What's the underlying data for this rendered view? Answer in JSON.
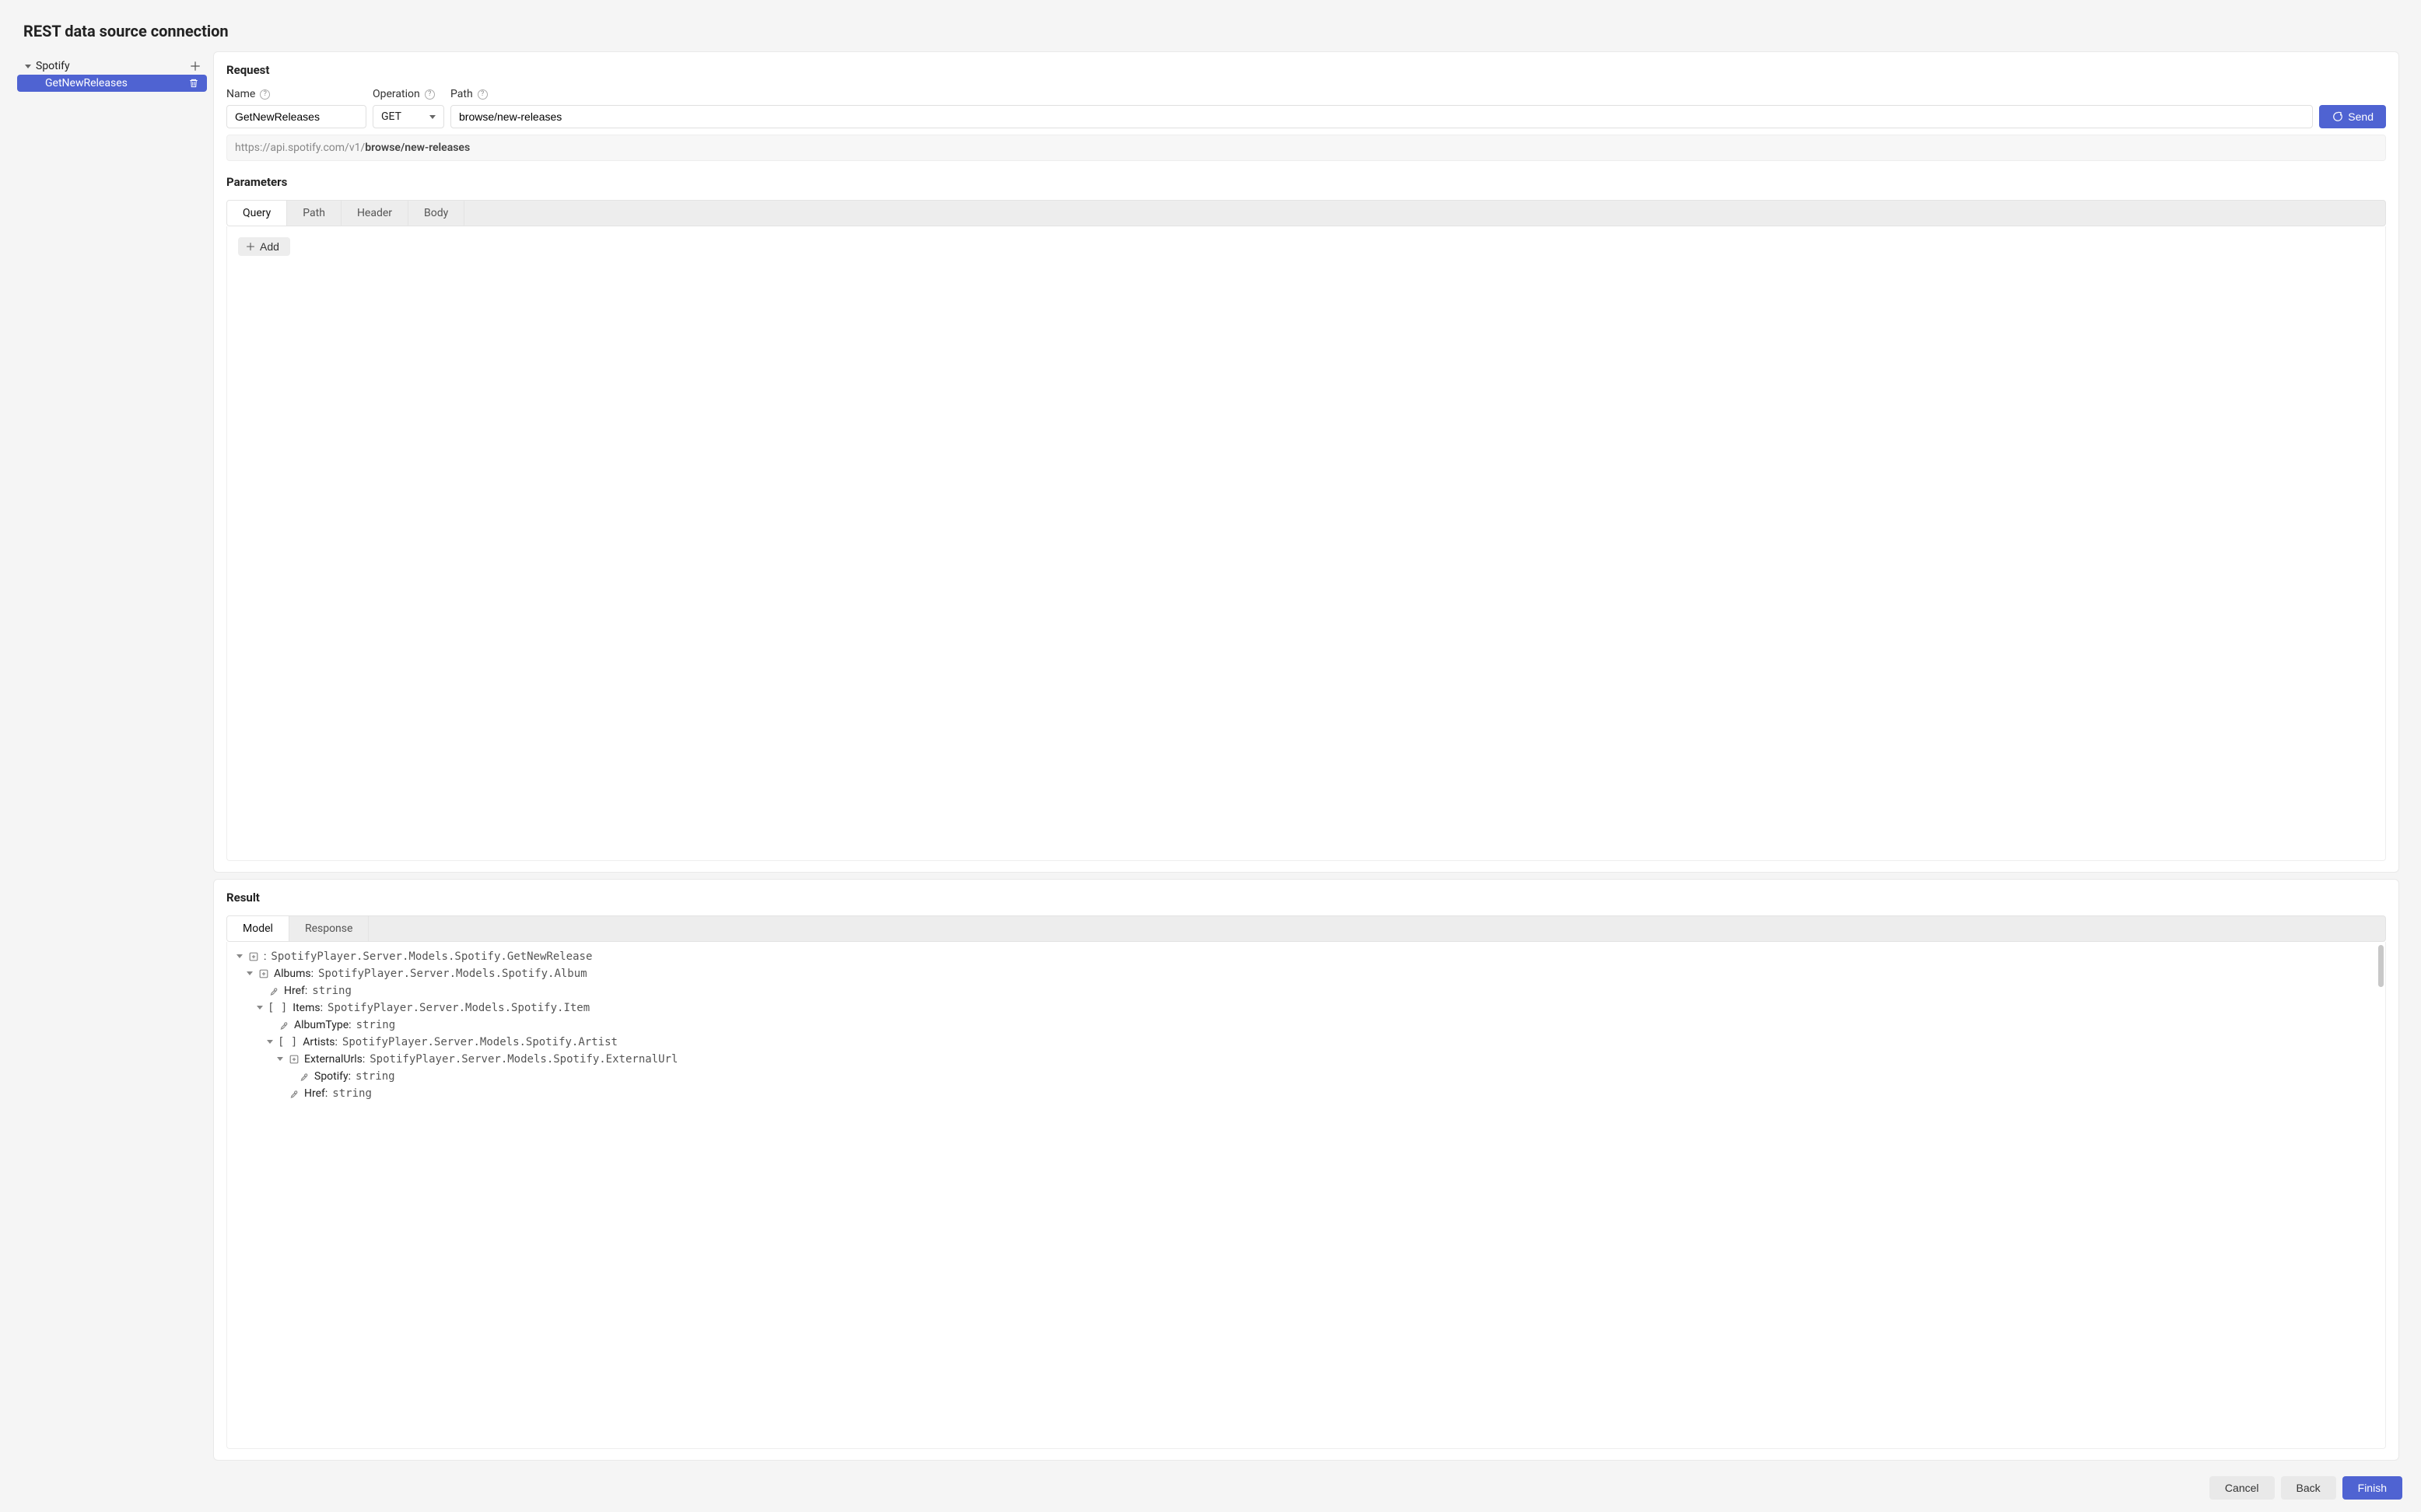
{
  "title": "REST data source connection",
  "sidebar": {
    "root": "Spotify",
    "leaf": "GetNewReleases"
  },
  "request": {
    "section": "Request",
    "name_label": "Name",
    "name_value": "GetNewReleases",
    "operation_label": "Operation",
    "operation_value": "GET",
    "path_label": "Path",
    "path_value": "browse/new-releases",
    "send": "Send",
    "url_base": "https://api.spotify.com/v1/",
    "url_path": "browse/new-releases"
  },
  "parameters": {
    "section": "Parameters",
    "tabs": [
      "Query",
      "Path",
      "Header",
      "Body"
    ],
    "add": "Add"
  },
  "result": {
    "section": "Result",
    "tabs": [
      "Model",
      "Response"
    ],
    "tree": [
      {
        "indent": 0,
        "chev": true,
        "icon": "object",
        "label": "<root>:",
        "type": "SpotifyPlayer.Server.Models.Spotify.GetNewRelease"
      },
      {
        "indent": 1,
        "chev": true,
        "icon": "object",
        "label": "Albums:",
        "type": "SpotifyPlayer.Server.Models.Spotify.Album"
      },
      {
        "indent": 2,
        "chev": false,
        "icon": "prop",
        "label": "Href:",
        "type": "string"
      },
      {
        "indent": 2,
        "chev": true,
        "icon": "array",
        "label": "Items:",
        "type": "SpotifyPlayer.Server.Models.Spotify.Item"
      },
      {
        "indent": 3,
        "chev": false,
        "icon": "prop",
        "label": "AlbumType:",
        "type": "string"
      },
      {
        "indent": 3,
        "chev": true,
        "icon": "array",
        "label": "Artists:",
        "type": "SpotifyPlayer.Server.Models.Spotify.Artist"
      },
      {
        "indent": 4,
        "chev": true,
        "icon": "object",
        "label": "ExternalUrls:",
        "type": "SpotifyPlayer.Server.Models.Spotify.ExternalUrl"
      },
      {
        "indent": 5,
        "chev": false,
        "icon": "prop",
        "label": "Spotify:",
        "type": "string"
      },
      {
        "indent": 4,
        "chev": false,
        "icon": "prop",
        "label": "Href:",
        "type": "string"
      }
    ]
  },
  "footer": {
    "cancel": "Cancel",
    "back": "Back",
    "finish": "Finish"
  }
}
